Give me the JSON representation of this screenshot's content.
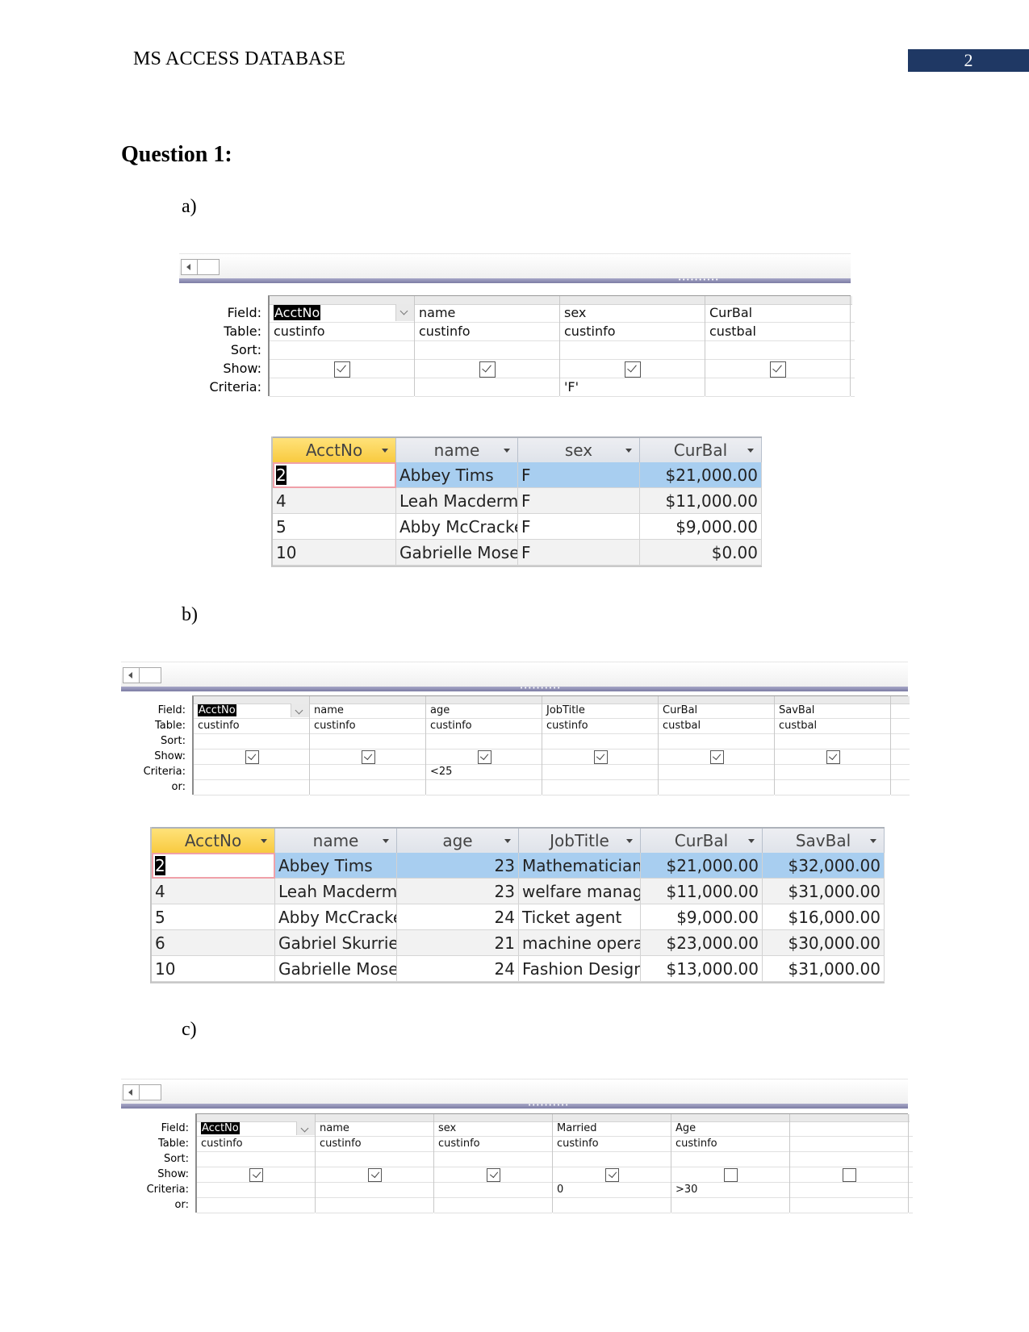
{
  "header": {
    "running_head": "MS ACCESS DATABASE",
    "page_number": "2",
    "accent_color": "#1f3864"
  },
  "question_title": "Question 1:",
  "grid_row_labels": {
    "field": "Field:",
    "table": "Table:",
    "sort": "Sort:",
    "show": "Show:",
    "criteria": "Criteria:",
    "or": "or:"
  },
  "parts": [
    {
      "label": "a)",
      "query": {
        "columns": [
          {
            "field": "AcctNo",
            "table": "custinfo",
            "sort": "",
            "show": true,
            "criteria": "",
            "selected": true
          },
          {
            "field": "name",
            "table": "custinfo",
            "sort": "",
            "show": true,
            "criteria": ""
          },
          {
            "field": "sex",
            "table": "custinfo",
            "sort": "",
            "show": true,
            "criteria": "'F'"
          },
          {
            "field": "CurBal",
            "table": "custbal",
            "sort": "",
            "show": true,
            "criteria": ""
          }
        ]
      },
      "results": {
        "headers": [
          "AcctNo",
          "name",
          "sex",
          "CurBal"
        ],
        "rows": [
          [
            "2",
            "Abbey Tims",
            "F",
            "$21,000.00"
          ],
          [
            "4",
            "Leah Macderm",
            "F",
            "$11,000.00"
          ],
          [
            "5",
            "Abby McCracke",
            "F",
            "$9,000.00"
          ],
          [
            "10",
            "Gabrielle Mose",
            "F",
            "$0.00"
          ]
        ]
      }
    },
    {
      "label": "b)",
      "query": {
        "columns": [
          {
            "field": "AcctNo",
            "table": "custinfo",
            "sort": "",
            "show": true,
            "criteria": "",
            "or": "",
            "selected": true
          },
          {
            "field": "name",
            "table": "custinfo",
            "sort": "",
            "show": true,
            "criteria": "",
            "or": ""
          },
          {
            "field": "age",
            "table": "custinfo",
            "sort": "",
            "show": true,
            "criteria": "<25",
            "or": ""
          },
          {
            "field": "JobTitle",
            "table": "custinfo",
            "sort": "",
            "show": true,
            "criteria": "",
            "or": ""
          },
          {
            "field": "CurBal",
            "table": "custbal",
            "sort": "",
            "show": true,
            "criteria": "",
            "or": ""
          },
          {
            "field": "SavBal",
            "table": "custbal",
            "sort": "",
            "show": true,
            "criteria": "",
            "or": ""
          }
        ]
      },
      "results": {
        "headers": [
          "AcctNo",
          "name",
          "age",
          "JobTitle",
          "CurBal",
          "SavBal"
        ],
        "rows": [
          [
            "2",
            "Abbey Tims",
            "23",
            "Mathematician",
            "$21,000.00",
            "$32,000.00"
          ],
          [
            "4",
            "Leah Macderm",
            "23",
            "welfare manag",
            "$11,000.00",
            "$31,000.00"
          ],
          [
            "5",
            "Abby McCracke",
            "24",
            "Ticket agent",
            "$9,000.00",
            "$16,000.00"
          ],
          [
            "6",
            "Gabriel Skurrie",
            "21",
            "machine opera",
            "$23,000.00",
            "$30,000.00"
          ],
          [
            "10",
            "Gabrielle Mose",
            "24",
            "Fashion Design",
            "$13,000.00",
            "$31,000.00"
          ]
        ]
      }
    },
    {
      "label": "c)",
      "query": {
        "columns": [
          {
            "field": "AcctNo",
            "table": "custinfo",
            "sort": "",
            "show": true,
            "criteria": "",
            "or": "",
            "selected": true
          },
          {
            "field": "name",
            "table": "custinfo",
            "sort": "",
            "show": true,
            "criteria": "",
            "or": ""
          },
          {
            "field": "sex",
            "table": "custinfo",
            "sort": "",
            "show": true,
            "criteria": "",
            "or": ""
          },
          {
            "field": "Married",
            "table": "custinfo",
            "sort": "",
            "show": true,
            "criteria": "0",
            "or": ""
          },
          {
            "field": "Age",
            "table": "custinfo",
            "sort": "",
            "show": false,
            "criteria": ">30",
            "or": ""
          },
          {
            "field": "",
            "table": "",
            "sort": "",
            "show": false,
            "criteria": "",
            "or": ""
          }
        ]
      }
    }
  ]
}
